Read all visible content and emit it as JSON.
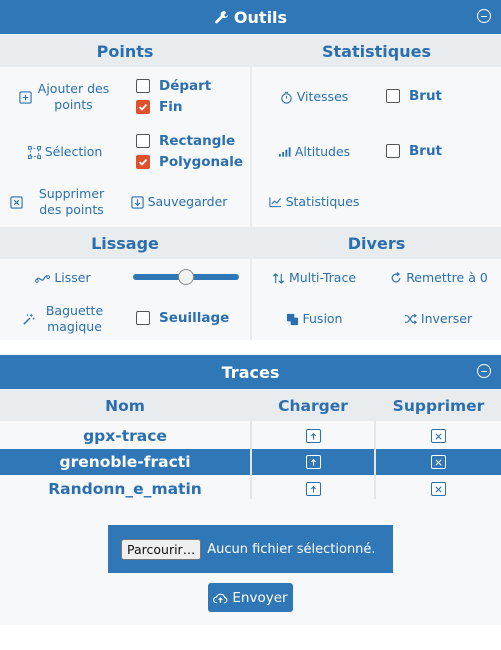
{
  "outils": {
    "title": "Outils",
    "points": {
      "title": "Points",
      "add_points": "Ajouter des points",
      "selection": "Sélection",
      "delete_points": "Supprimer des points",
      "save": "Sauvegarder",
      "depart": {
        "label": "Départ",
        "checked": false
      },
      "fin": {
        "label": "Fin",
        "checked": true
      },
      "rectangle": {
        "label": "Rectangle",
        "checked": false
      },
      "polygonale": {
        "label": "Polygonale",
        "checked": true
      }
    },
    "stats": {
      "title": "Statistiques",
      "vitesses": "Vitesses",
      "altitudes": "Altitudes",
      "statistiques": "Statistiques",
      "brut1": {
        "label": "Brut",
        "checked": false
      },
      "brut2": {
        "label": "Brut",
        "checked": false
      }
    },
    "lissage": {
      "title": "Lissage",
      "lisser": "Lisser",
      "slider_level": 0.5,
      "baguette": "Baguette magique",
      "seuillage": {
        "label": "Seuillage",
        "checked": false
      }
    },
    "divers": {
      "title": "Divers",
      "multi_trace": "Multi-Trace",
      "remettre": "Remettre à 0",
      "fusion": "Fusion",
      "inverser": "Inverser"
    }
  },
  "traces": {
    "title": "Traces",
    "headers": {
      "nom": "Nom",
      "charger": "Charger",
      "supprimer": "Supprimer"
    },
    "rows": [
      {
        "name": "gpx-trace",
        "selected": false
      },
      {
        "name": "grenoble-fracti",
        "selected": true
      },
      {
        "name": "Randonn_e_matin",
        "selected": false
      }
    ],
    "browse_label": "Parcourir…",
    "no_file": "Aucun fichier sélectionné.",
    "send_label": "Envoyer"
  },
  "colors": {
    "primary": "#2f77b6",
    "accent": "#e0502c",
    "panel_bg": "#f6f8fa",
    "section_bg": "#e9ecef"
  }
}
